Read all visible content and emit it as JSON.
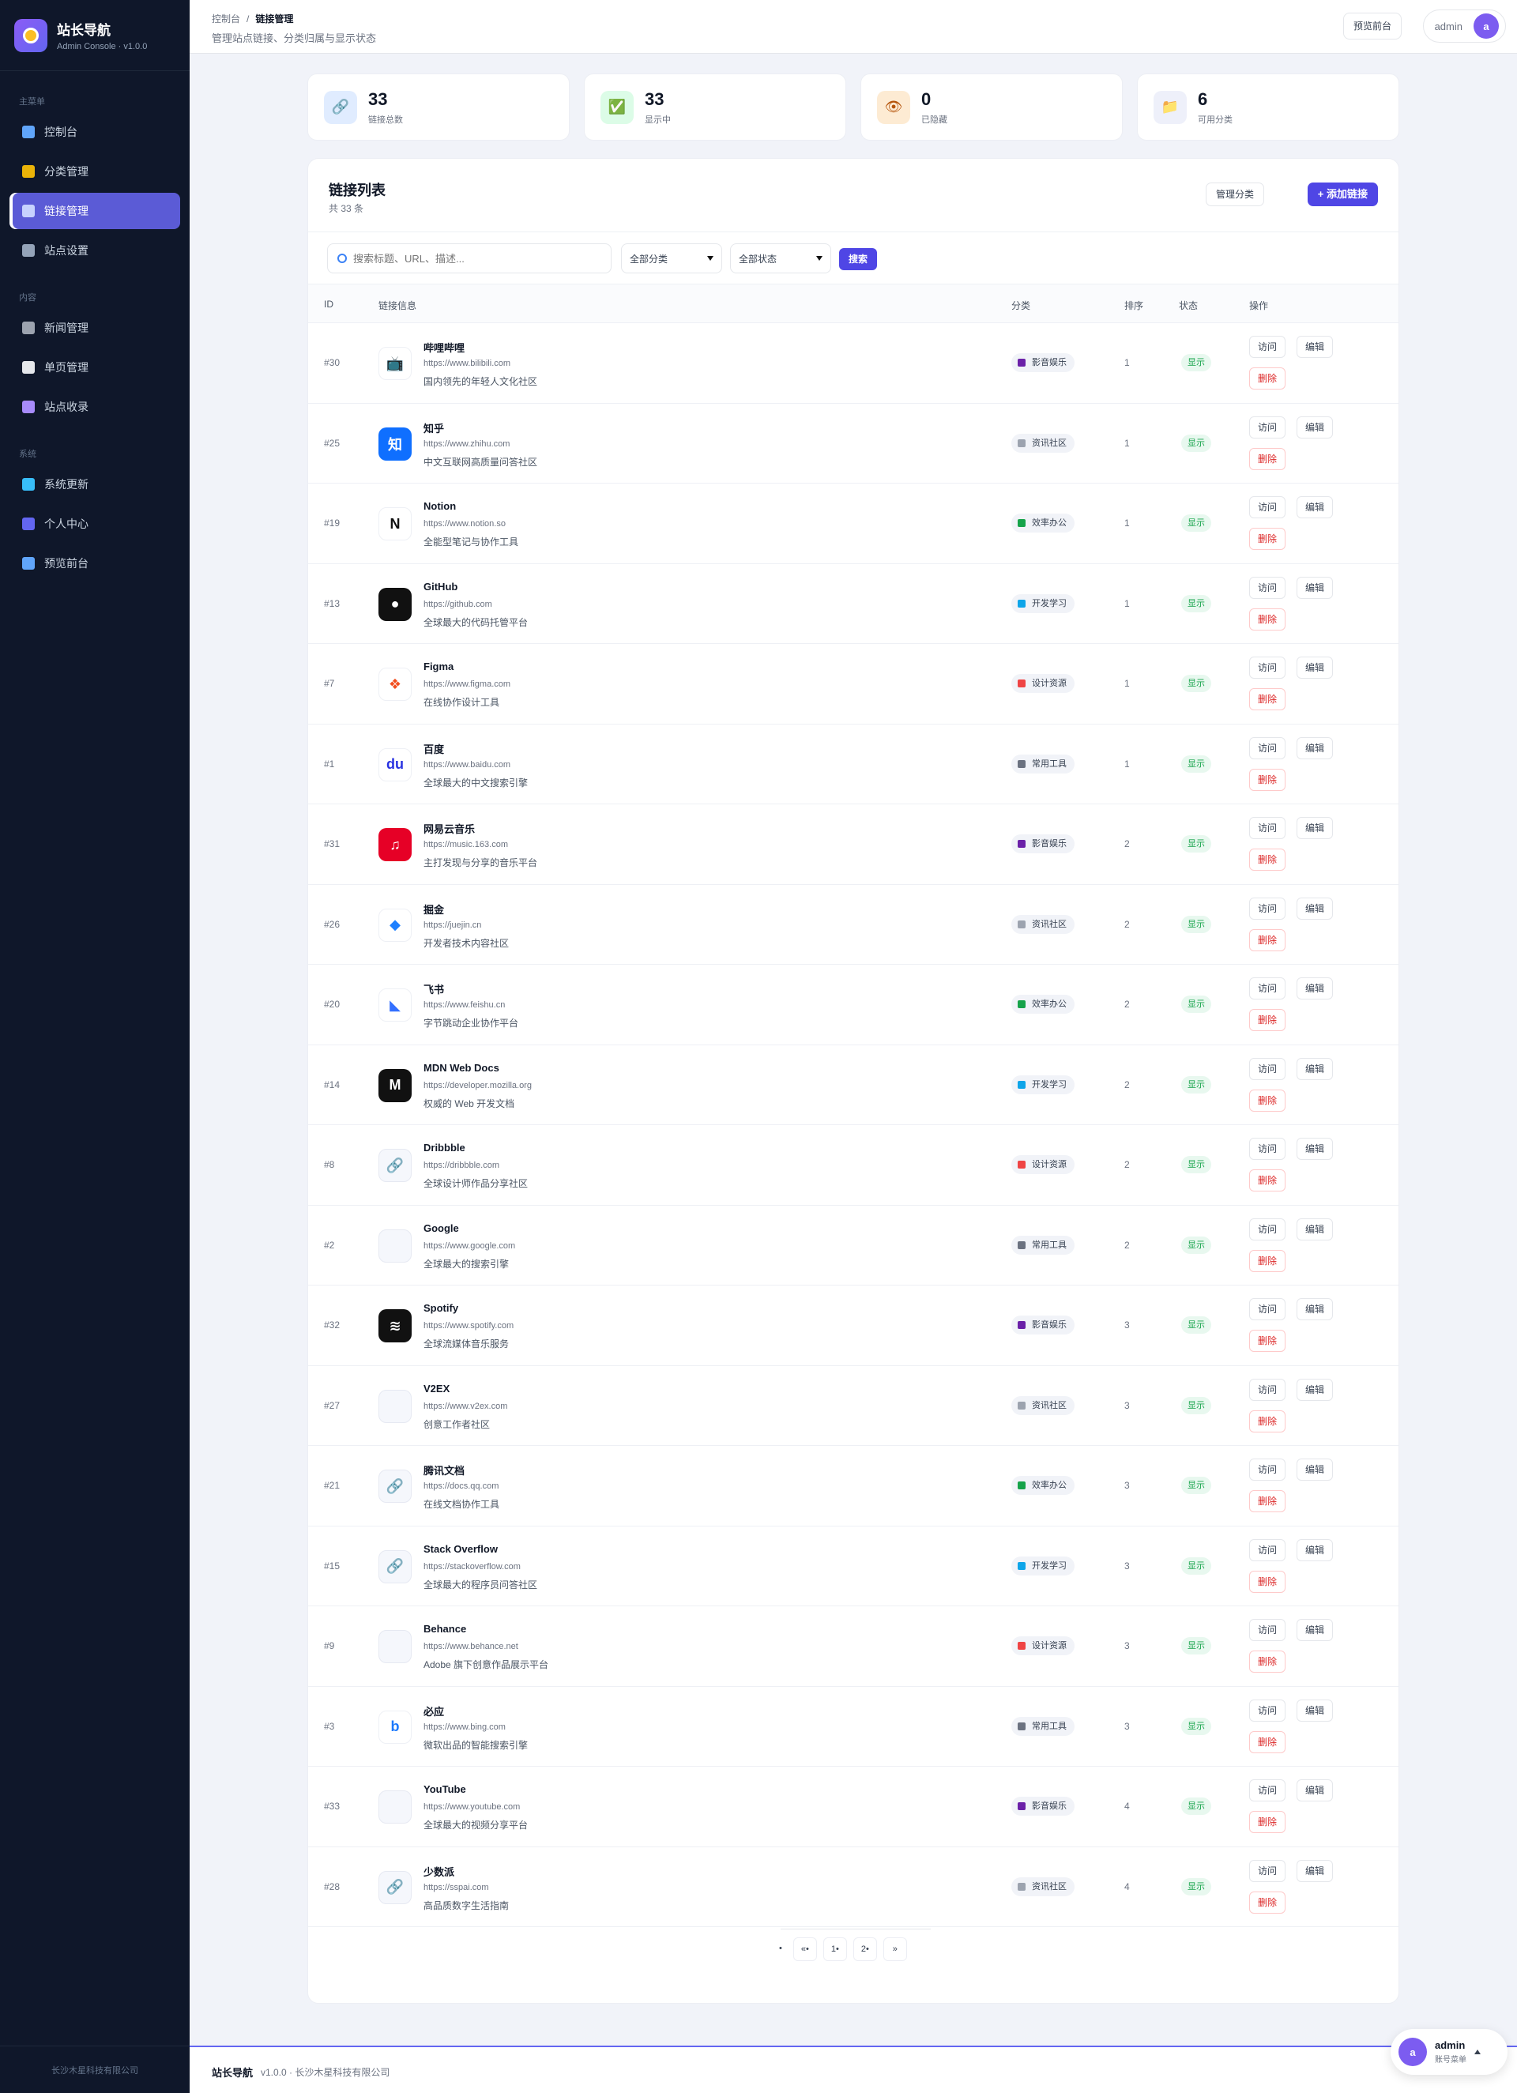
{
  "sidebar": {
    "brand": {
      "name": "站长导航",
      "sub": "Admin Console · v1.0.0"
    },
    "sections": [
      {
        "label": "主菜单",
        "items": [
          {
            "label": "控制台",
            "icon": "chart-icon",
            "color": "#60a5fa",
            "active": false
          },
          {
            "label": "分类管理",
            "icon": "folder-icon",
            "color": "#eab308",
            "active": false
          },
          {
            "label": "链接管理",
            "icon": "link-icon",
            "color": "#c7d2fe",
            "active": true
          },
          {
            "label": "站点设置",
            "icon": "gear-icon",
            "color": "#94a3b8",
            "active": false
          }
        ]
      },
      {
        "label": "内容",
        "items": [
          {
            "label": "新闻管理",
            "icon": "newspaper-icon",
            "color": "#9ca3af",
            "active": false
          },
          {
            "label": "单页管理",
            "icon": "page-icon",
            "color": "#e5e7eb",
            "active": false
          },
          {
            "label": "站点收录",
            "icon": "inbox-icon",
            "color": "#a78bfa",
            "active": false
          }
        ]
      },
      {
        "label": "系统",
        "items": [
          {
            "label": "系统更新",
            "icon": "upload-icon",
            "color": "#38bdf8",
            "active": false
          },
          {
            "label": "个人中心",
            "icon": "user-icon",
            "color": "#6366f1",
            "active": false
          },
          {
            "label": "预览前台",
            "icon": "globe-icon",
            "color": "#60a5fa",
            "active": false
          }
        ]
      }
    ],
    "footer": "长沙木星科技有限公司"
  },
  "header": {
    "breadcrumb": [
      "控制台",
      "链接管理"
    ],
    "description": "管理站点链接、分类归属与显示状态",
    "preview_label": "预览前台",
    "user": "admin",
    "avatar_letter": "a"
  },
  "stats": [
    {
      "value": "33",
      "label": "链接总数",
      "icon": "link-icon",
      "bg": "#e0ecff",
      "fg": "#3b82f6",
      "glyph": "🔗"
    },
    {
      "value": "33",
      "label": "显示中",
      "icon": "check-icon",
      "bg": "#dcfce7",
      "fg": "#16a34a",
      "glyph": "✅"
    },
    {
      "value": "0",
      "label": "已隐藏",
      "icon": "eye-icon",
      "bg": "#fdebd3",
      "fg": "#b45309",
      "glyph": "👁"
    },
    {
      "value": "6",
      "label": "可用分类",
      "icon": "folder-icon",
      "bg": "#eef0fa",
      "fg": "#eab308",
      "glyph": "📁"
    }
  ],
  "panel": {
    "title": "链接列表",
    "count": "共 33 条",
    "manage_label": "管理分类",
    "add_label": "+ 添加链接",
    "search_placeholder": "搜索标题、URL、描述...",
    "category_filter": "全部分类",
    "status_filter": "全部状态",
    "search_label": "搜索",
    "columns": {
      "id": "ID",
      "info": "链接信息",
      "category": "分类",
      "sort": "排序",
      "status": "状态",
      "actions": "操作"
    },
    "visit_label": "访问",
    "edit_label": "编辑",
    "delete_label": "删除"
  },
  "categories": {
    "影音娱乐": "#6b21a8",
    "资讯社区": "#9ca3af",
    "效率办公": "#16a34a",
    "开发学习": "#0ea5e9",
    "设计资源": "#ef4444",
    "常用工具": "#6b7280"
  },
  "links": [
    {
      "id": "#30",
      "name": "哔哩哔哩",
      "url": "https://www.bilibili.com",
      "desc": "国内领先的年轻人文化社区",
      "category": "影音娱乐",
      "sort": "1",
      "status": "显示",
      "logo": "bilibili",
      "logo_bg": "#ffffff",
      "logo_fg": "#00a1d6",
      "logo_text": "📺"
    },
    {
      "id": "#25",
      "name": "知乎",
      "url": "https://www.zhihu.com",
      "desc": "中文互联网高质量问答社区",
      "category": "资讯社区",
      "sort": "1",
      "status": "显示",
      "logo": "zhihu",
      "logo_bg": "#0f6fff",
      "logo_fg": "#ffffff",
      "logo_text": "知"
    },
    {
      "id": "#19",
      "name": "Notion",
      "url": "https://www.notion.so",
      "desc": "全能型笔记与协作工具",
      "category": "效率办公",
      "sort": "1",
      "status": "显示",
      "logo": "notion",
      "logo_bg": "#ffffff",
      "logo_fg": "#111111",
      "logo_text": "N"
    },
    {
      "id": "#13",
      "name": "GitHub",
      "url": "https://github.com",
      "desc": "全球最大的代码托管平台",
      "category": "开发学习",
      "sort": "1",
      "status": "显示",
      "logo": "github",
      "logo_bg": "#111111",
      "logo_fg": "#ffffff",
      "logo_text": "●"
    },
    {
      "id": "#7",
      "name": "Figma",
      "url": "https://www.figma.com",
      "desc": "在线协作设计工具",
      "category": "设计资源",
      "sort": "1",
      "status": "显示",
      "logo": "figma",
      "logo_bg": "#ffffff",
      "logo_fg": "#f24e1e",
      "logo_text": "❖"
    },
    {
      "id": "#1",
      "name": "百度",
      "url": "https://www.baidu.com",
      "desc": "全球最大的中文搜索引擎",
      "category": "常用工具",
      "sort": "1",
      "status": "显示",
      "logo": "baidu",
      "logo_bg": "#ffffff",
      "logo_fg": "#2932e1",
      "logo_text": "du"
    },
    {
      "id": "#31",
      "name": "网易云音乐",
      "url": "https://music.163.com",
      "desc": "主打发现与分享的音乐平台",
      "category": "影音娱乐",
      "sort": "2",
      "status": "显示",
      "logo": "netease",
      "logo_bg": "#e60026",
      "logo_fg": "#ffffff",
      "logo_text": "♫"
    },
    {
      "id": "#26",
      "name": "掘金",
      "url": "https://juejin.cn",
      "desc": "开发者技术内容社区",
      "category": "资讯社区",
      "sort": "2",
      "status": "显示",
      "logo": "juejin",
      "logo_bg": "#ffffff",
      "logo_fg": "#1e80ff",
      "logo_text": "◆"
    },
    {
      "id": "#20",
      "name": "飞书",
      "url": "https://www.feishu.cn",
      "desc": "字节跳动企业协作平台",
      "category": "效率办公",
      "sort": "2",
      "status": "显示",
      "logo": "feishu",
      "logo_bg": "#ffffff",
      "logo_fg": "#3370ff",
      "logo_text": "◣"
    },
    {
      "id": "#14",
      "name": "MDN Web Docs",
      "url": "https://developer.mozilla.org",
      "desc": "权威的 Web 开发文档",
      "category": "开发学习",
      "sort": "2",
      "status": "显示",
      "logo": "mdn",
      "logo_bg": "#111111",
      "logo_fg": "#ffffff",
      "logo_text": "M"
    },
    {
      "id": "#8",
      "name": "Dribbble",
      "url": "https://dribbble.com",
      "desc": "全球设计师作品分享社区",
      "category": "设计资源",
      "sort": "2",
      "status": "显示",
      "logo": "link",
      "logo_bg": "",
      "logo_fg": "",
      "logo_text": "🔗"
    },
    {
      "id": "#2",
      "name": "Google",
      "url": "https://www.google.com",
      "desc": "全球最大的搜索引擎",
      "category": "常用工具",
      "sort": "2",
      "status": "显示",
      "logo": "empty",
      "logo_bg": "",
      "logo_fg": "",
      "logo_text": ""
    },
    {
      "id": "#32",
      "name": "Spotify",
      "url": "https://www.spotify.com",
      "desc": "全球流媒体音乐服务",
      "category": "影音娱乐",
      "sort": "3",
      "status": "显示",
      "logo": "spotify",
      "logo_bg": "#111111",
      "logo_fg": "#ffffff",
      "logo_text": "≋"
    },
    {
      "id": "#27",
      "name": "V2EX",
      "url": "https://www.v2ex.com",
      "desc": "创意工作者社区",
      "category": "资讯社区",
      "sort": "3",
      "status": "显示",
      "logo": "empty",
      "logo_bg": "",
      "logo_fg": "",
      "logo_text": ""
    },
    {
      "id": "#21",
      "name": "腾讯文档",
      "url": "https://docs.qq.com",
      "desc": "在线文档协作工具",
      "category": "效率办公",
      "sort": "3",
      "status": "显示",
      "logo": "link",
      "logo_bg": "",
      "logo_fg": "",
      "logo_text": "🔗"
    },
    {
      "id": "#15",
      "name": "Stack Overflow",
      "url": "https://stackoverflow.com",
      "desc": "全球最大的程序员问答社区",
      "category": "开发学习",
      "sort": "3",
      "status": "显示",
      "logo": "link",
      "logo_bg": "",
      "logo_fg": "",
      "logo_text": "🔗"
    },
    {
      "id": "#9",
      "name": "Behance",
      "url": "https://www.behance.net",
      "desc": "Adobe 旗下创意作品展示平台",
      "category": "设计资源",
      "sort": "3",
      "status": "显示",
      "logo": "empty",
      "logo_bg": "",
      "logo_fg": "",
      "logo_text": ""
    },
    {
      "id": "#3",
      "name": "必应",
      "url": "https://www.bing.com",
      "desc": "微软出品的智能搜索引擎",
      "category": "常用工具",
      "sort": "3",
      "status": "显示",
      "logo": "bing",
      "logo_bg": "#ffffff",
      "logo_fg": "#1d7afc",
      "logo_text": "b"
    },
    {
      "id": "#33",
      "name": "YouTube",
      "url": "https://www.youtube.com",
      "desc": "全球最大的视频分享平台",
      "category": "影音娱乐",
      "sort": "4",
      "status": "显示",
      "logo": "empty",
      "logo_bg": "",
      "logo_fg": "",
      "logo_text": ""
    },
    {
      "id": "#28",
      "name": "少数派",
      "url": "https://sspai.com",
      "desc": "高品质数字生活指南",
      "category": "资讯社区",
      "sort": "4",
      "status": "显示",
      "logo": "link",
      "logo_bg": "",
      "logo_fg": "",
      "logo_text": "🔗"
    }
  ],
  "pagination": {
    "items": [
      "•",
      "«•",
      "1•",
      "2•",
      "»"
    ]
  },
  "footer": {
    "brand": "站长导航",
    "meta": "v1.0.0 · 长沙木星科技有限公司",
    "float_user": "admin",
    "float_sub": "账号菜单",
    "float_letter": "a"
  }
}
